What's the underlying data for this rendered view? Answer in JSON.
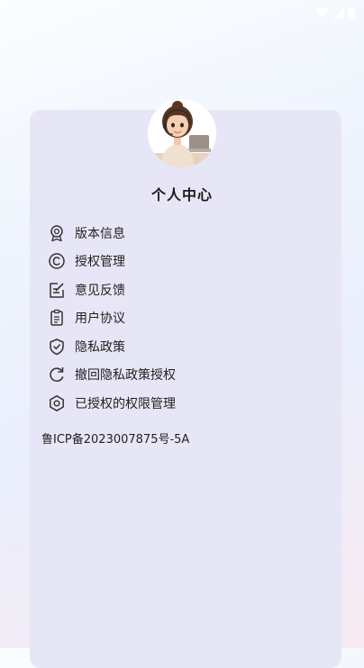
{
  "status_bar": {
    "icons": [
      "wifi-icon",
      "signal-icon",
      "battery-icon"
    ]
  },
  "profile": {
    "title": "个人中心"
  },
  "menu": {
    "items": [
      {
        "label": "版本信息",
        "icon": "badge-icon"
      },
      {
        "label": "授权管理",
        "icon": "copyright-icon"
      },
      {
        "label": "意见反馈",
        "icon": "edit-note-icon"
      },
      {
        "label": "用户协议",
        "icon": "clipboard-icon"
      },
      {
        "label": "隐私政策",
        "icon": "shield-check-icon"
      },
      {
        "label": "撤回隐私政策授权",
        "icon": "refresh-icon"
      },
      {
        "label": "已授权的权限管理",
        "icon": "settings-icon"
      }
    ]
  },
  "footer": {
    "icp": "鲁ICP备2023007875号-5A"
  },
  "colors": {
    "card_background": "#e7e6f6",
    "text": "#222222"
  }
}
